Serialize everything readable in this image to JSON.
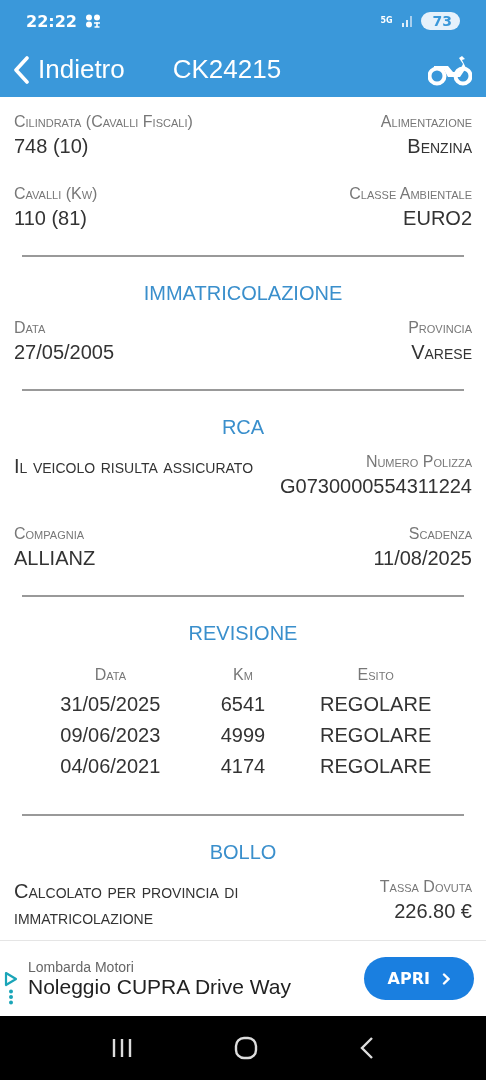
{
  "status_bar": {
    "time": "22:22",
    "network": "5G",
    "battery": "73"
  },
  "header": {
    "back": "Indietro",
    "title": "CK24215"
  },
  "sections": [
    {
      "kind": "fields",
      "rows": [
        {
          "left": {
            "label": "Cilindrata (Cavalli Fiscali)",
            "value": "748 (10)"
          },
          "right": {
            "label": "Alimentazione",
            "value": "Benzina"
          }
        },
        {
          "left": {
            "label": "Cavalli (Kw)",
            "value": "110 (81)"
          },
          "right": {
            "label": "Classe Ambientale",
            "value": "EURO2"
          }
        }
      ]
    },
    {
      "kind": "fields",
      "title": "IMMATRICOLAZIONE",
      "rows": [
        {
          "left": {
            "label": "Data",
            "value": "27/05/2005"
          },
          "right": {
            "label": "Provincia",
            "value": "Varese"
          }
        }
      ]
    },
    {
      "kind": "fields",
      "title": "RCA",
      "rows": [
        {
          "left": {
            "note": "Il veicolo risulta assicurato"
          },
          "right": {
            "label": "Numero Polizza",
            "value": "G0730000554311224"
          }
        },
        {
          "left": {
            "label": "Compagnia",
            "value": "ALLIANZ"
          },
          "right": {
            "label": "Scadenza",
            "value": "11/08/2025"
          }
        }
      ]
    },
    {
      "kind": "table",
      "title": "REVISIONE",
      "columns": [
        "Data",
        "Km",
        "Esito"
      ],
      "rows": [
        [
          "31/05/2025",
          "6541",
          "REGOLARE"
        ],
        [
          "09/06/2023",
          "4999",
          "REGOLARE"
        ],
        [
          "04/06/2021",
          "4174",
          "REGOLARE"
        ]
      ]
    },
    {
      "kind": "fields",
      "title": "BOLLO",
      "rows": [
        {
          "left": {
            "note": "Calcolato per provincia di immatricolazione"
          },
          "right": {
            "label": "Tassa Dovuta",
            "value": "226.80 €"
          }
        }
      ]
    }
  ],
  "ad": {
    "advertiser": "Lombarda Motori",
    "headline": "Noleggio CUPRA Drive Way",
    "button": "APRI"
  }
}
